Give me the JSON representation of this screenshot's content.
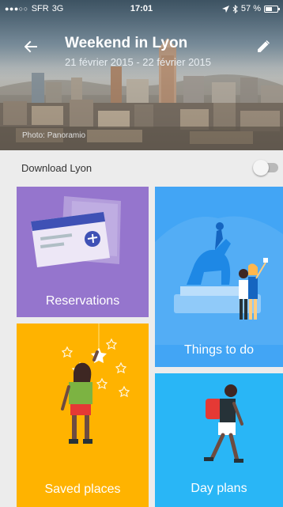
{
  "status_bar": {
    "carrier": "SFR",
    "network": "3G",
    "time": "17:01",
    "battery": "57 %",
    "battery_level": 0.57
  },
  "header": {
    "title": "Weekend in Lyon",
    "dates": "21 février 2015 - 22 février 2015",
    "photo_credit": "Photo: Panoramio",
    "back_icon": "arrow-left-icon",
    "edit_icon": "pencil-icon"
  },
  "download": {
    "label": "Download Lyon",
    "enabled": false
  },
  "tiles": {
    "reservations": {
      "label": "Reservations",
      "color": "#9575cd"
    },
    "things_to_do": {
      "label": "Things to do",
      "color": "#42a5f5"
    },
    "saved_places": {
      "label": "Saved places",
      "color": "#ffb300"
    },
    "day_plans": {
      "label": "Day plans",
      "color": "#29b6f6"
    }
  }
}
